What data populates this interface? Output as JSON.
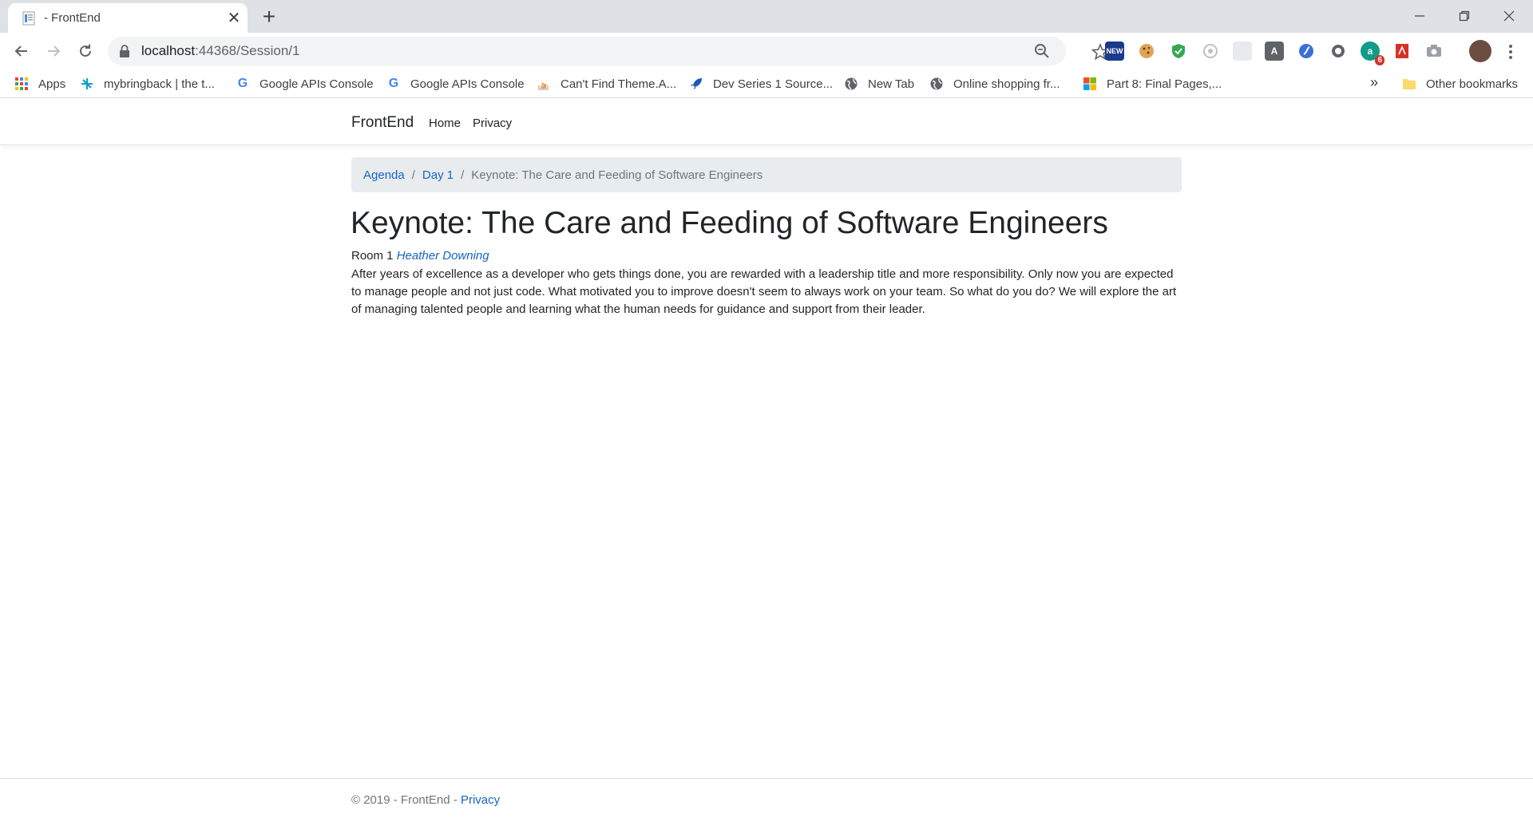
{
  "browser": {
    "tab": {
      "title": "- FrontEnd",
      "favicon": "page-icon"
    },
    "address": {
      "host": "localhost",
      "rest": ":44368/Session/1"
    },
    "bookmarks": [
      {
        "label": "Apps",
        "icon": "apps-grid-icon"
      },
      {
        "label": "mybringback | the t...",
        "icon": "mybringback-icon"
      },
      {
        "label": "Google APIs Console",
        "icon": "google-icon"
      },
      {
        "label": "Google APIs Console",
        "icon": "google-icon"
      },
      {
        "label": "Can't Find Theme.A...",
        "icon": "stackoverflow-icon"
      },
      {
        "label": "Dev Series 1 Source...",
        "icon": "rocket-icon"
      },
      {
        "label": "New Tab",
        "icon": "globe-icon"
      },
      {
        "label": "Online shopping fr...",
        "icon": "globe-icon"
      },
      {
        "label": "Part 8: Final Pages,...",
        "icon": "microsoft-icon"
      }
    ],
    "other_bookmarks": "Other bookmarks",
    "extension_badge": "6"
  },
  "site": {
    "brand": "FrontEnd",
    "nav": [
      "Home",
      "Privacy"
    ]
  },
  "breadcrumb": {
    "items": [
      "Agenda",
      "Day 1"
    ],
    "active": "Keynote: The Care and Feeding of Software Engineers",
    "separator": "/"
  },
  "session": {
    "title": "Keynote: The Care and Feeding of Software Engineers",
    "room": "Room 1",
    "speaker": "Heather Downing",
    "description": "After years of excellence as a developer who gets things done, you are rewarded with a leadership title and more responsibility. Only now you are expected to manage people and not just code. What motivated you to improve doesn't seem to always work on your team. So what do you do? We will explore the art of managing talented people and learning what the human needs for guidance and support from their leader."
  },
  "footer": {
    "text": "© 2019 - FrontEnd - ",
    "link": "Privacy"
  },
  "colors": {
    "link": "#1565c0",
    "breadcrumb_bg": "#e9ecef",
    "chrome_bg": "#dee1e6"
  }
}
